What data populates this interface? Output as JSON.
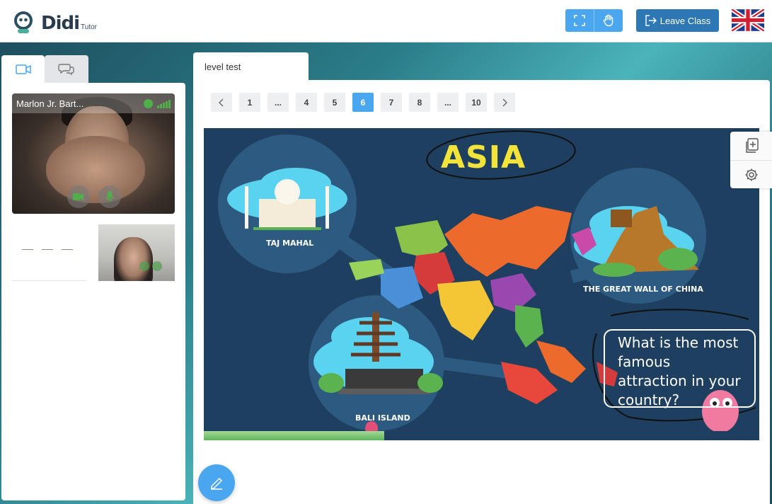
{
  "header": {
    "logo_text": "Didi",
    "logo_sub": "Tutor",
    "leave_label": "Leave Class",
    "icons": [
      "fullscreen-icon",
      "hand-icon",
      "exit-icon",
      "uk-flag-icon"
    ]
  },
  "sidebar": {
    "tabs": [
      "video-camera-icon",
      "chat-icon"
    ],
    "main_video": {
      "name": "Marlon Jr. Bart..."
    }
  },
  "document": {
    "tab_label": "level test",
    "pages": [
      "1",
      "...",
      "4",
      "5",
      "6",
      "7",
      "8",
      "...",
      "10"
    ],
    "current_page": "6"
  },
  "slide": {
    "title": "ASIA",
    "taj_label": "TAJ MAHAL",
    "wall_label": "THE GREAT WALL OF CHINA",
    "bali_label": "BALI ISLAND",
    "question_lines": [
      "What is the most",
      "famous",
      "attraction in your",
      "country?"
    ],
    "progress": 0.325
  },
  "colors": {
    "accent": "#4ba6f0",
    "leave": "#2d77b5",
    "slide_bg": "#1e3f60",
    "title": "#f4e43a",
    "status_green": "#4fb04a"
  }
}
